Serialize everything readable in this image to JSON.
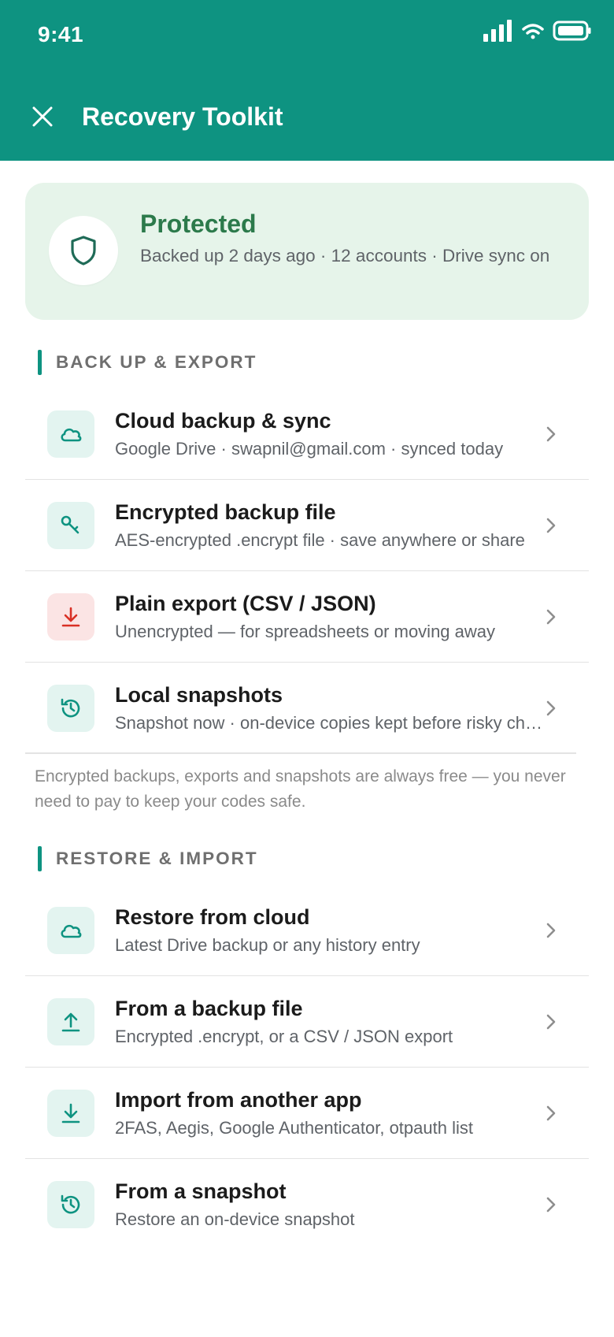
{
  "status_bar": {
    "time": "9:41"
  },
  "app_bar": {
    "title": "Recovery Toolkit",
    "close_icon": "close-icon"
  },
  "colors": {
    "primary": "#0e9381",
    "protected_green": "#2c7a4b",
    "hero_bg": "#e6f4ea",
    "danger_red": "#d93025"
  },
  "status_card": {
    "title": "Protected",
    "subtitle": "Backed up 2 days ago · 12 accounts · Drive sync on",
    "icon": "shield-icon"
  },
  "backup_section": {
    "label": "BACK UP & EXPORT",
    "items": [
      {
        "title": "Cloud backup & sync",
        "subtitle": "Google Drive · swapnil@gmail.com · synced today",
        "icon": "cloud-icon"
      },
      {
        "title": "Encrypted backup file",
        "subtitle": "AES-encrypted .encrypt file · save anywhere or share",
        "icon": "key-icon"
      },
      {
        "title": "Plain export (CSV / JSON)",
        "subtitle": "Unencrypted — for spreadsheets or moving away",
        "icon": "download-icon"
      },
      {
        "title": "Local snapshots",
        "subtitle": "Snapshot now · on-device copies kept before risky changes",
        "icon": "history-icon"
      }
    ],
    "footnote": "Encrypted backups, exports and snapshots are always free — you never need to pay to keep your codes safe."
  },
  "restore_section": {
    "label": "RESTORE & IMPORT",
    "items": [
      {
        "title": "Restore from cloud",
        "subtitle": "Latest Drive backup or any history entry",
        "icon": "cloud-icon"
      },
      {
        "title": "From a backup file",
        "subtitle": "Encrypted .encrypt, or a CSV / JSON export",
        "icon": "upload-icon"
      },
      {
        "title": "Import from another app",
        "subtitle": "2FAS, Aegis, Google Authenticator, otpauth list",
        "icon": "download-icon"
      },
      {
        "title": "From a snapshot",
        "subtitle": "Restore an on-device snapshot",
        "icon": "history-icon"
      }
    ]
  }
}
